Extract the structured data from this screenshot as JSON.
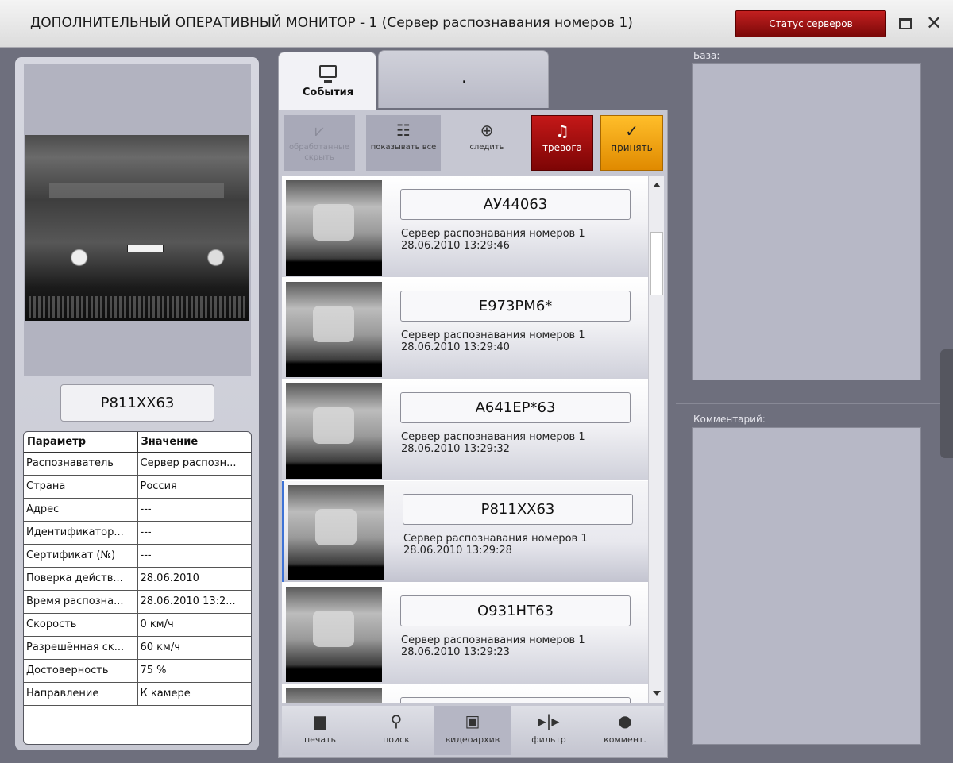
{
  "window": {
    "title": "ДОПОЛНИТЕЛЬНЫЙ ОПЕРАТИВНЫЙ МОНИТОР - 1  (Сервер распознавания номеров 1)",
    "status_button": "Статус серверов",
    "maximize_icon": "maximize-icon",
    "close_icon": "✕"
  },
  "left": {
    "recognized_plate": "Р811ХХ63",
    "table_headers": [
      "Параметр",
      "Значение"
    ],
    "rows": [
      [
        "Распознаватель",
        "Сервер распозн..."
      ],
      [
        "Страна",
        "Россия"
      ],
      [
        "Адрес",
        "---"
      ],
      [
        "Идентификатор...",
        "---"
      ],
      [
        "Сертификат (№)",
        "---"
      ],
      [
        "Поверка действ...",
        "28.06.2010"
      ],
      [
        "Время распозна...",
        "28.06.2010 13:2..."
      ],
      [
        "Скорость",
        "0 км/ч"
      ],
      [
        "Разрешённая ск...",
        "60 км/ч"
      ],
      [
        "Достоверность",
        "75 %"
      ],
      [
        "Направление",
        "К камере"
      ]
    ]
  },
  "tabs": {
    "events": "События",
    "other": "."
  },
  "toolbar": {
    "hide": "обработанные скрыть",
    "show": "показывать все",
    "follow": "следить",
    "alarm": "тревога",
    "accept": "принять"
  },
  "events": [
    {
      "plate": "АУ44063",
      "server": "Сервер распознавания номеров 1",
      "time": "28.06.2010 13:29:46"
    },
    {
      "plate": "Е973РМ6*",
      "server": "Сервер распознавания номеров 1",
      "time": "28.06.2010 13:29:40"
    },
    {
      "plate": "А641ЕР*63",
      "server": "Сервер распознавания номеров 1",
      "time": "28.06.2010 13:29:32"
    },
    {
      "plate": "Р811ХХ63",
      "server": "Сервер распознавания номеров 1",
      "time": "28.06.2010 13:29:28"
    },
    {
      "plate": "О931НТ63",
      "server": "Сервер распознавания номеров 1",
      "time": "28.06.2010 13:29:23"
    }
  ],
  "bottom_bar": {
    "print": "печать",
    "search": "поиск",
    "archive": "видеоархив",
    "filter": "фильтр",
    "comment": "коммент."
  },
  "right": {
    "base_label": "База:",
    "comment_label": "Комментарий:"
  },
  "colors": {
    "status_button": "#9e1010",
    "alarm": "#a80f0f",
    "accept": "#f2a417",
    "selection": "#3d72d6"
  }
}
